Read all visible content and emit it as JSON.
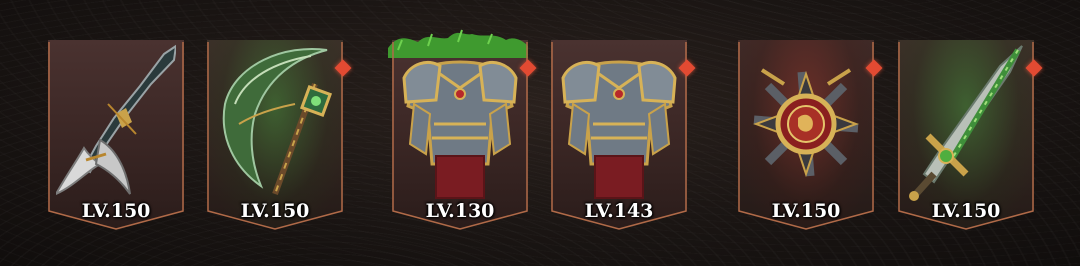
{
  "equipment": [
    {
      "slot": "weapon",
      "icon": "axe-blade-icon",
      "level": "LV.150",
      "has_gem": false,
      "rarity_glow": "none"
    },
    {
      "slot": "offhand",
      "icon": "green-scythe-icon",
      "level": "LV.150",
      "has_gem": true,
      "rarity_glow": "green"
    },
    {
      "slot": "armor",
      "icon": "plate-armor-icon",
      "level": "LV.130",
      "has_gem": true,
      "rarity_glow": "green-moss"
    },
    {
      "slot": "armor",
      "icon": "plate-armor-icon",
      "level": "LV.143",
      "has_gem": true,
      "rarity_glow": "none"
    },
    {
      "slot": "medal",
      "icon": "medal-emblem-icon",
      "level": "LV.150",
      "has_gem": true,
      "rarity_glow": "red"
    },
    {
      "slot": "weapon",
      "icon": "green-sword-icon",
      "level": "LV.150",
      "has_gem": true,
      "rarity_glow": "green"
    }
  ],
  "colors": {
    "frame": "#b06a48",
    "gem": "#e24a32",
    "level_text": "#ffffff"
  }
}
